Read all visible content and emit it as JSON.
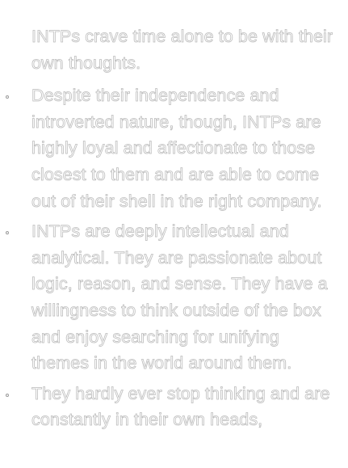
{
  "intro": {
    "text": "INTPs crave time alone to be with their own thoughts."
  },
  "bullets": [
    {
      "text": "Despite their independence and introverted nature, though, INTPs are highly loyal and affectionate to those closest to them and are able to come out of their shell in the right company."
    },
    {
      "text": "INTPs are deeply intellectual and analytical. They are passionate about logic, reason, and sense. They have a willingness to think outside of the box and enjoy searching for unifying themes in the world around them."
    },
    {
      "text": "They hardly ever stop thinking and are constantly in their own heads,"
    }
  ]
}
